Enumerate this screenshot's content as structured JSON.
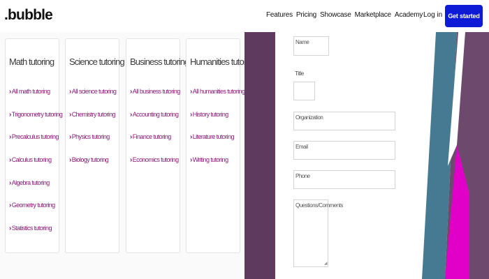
{
  "header": {
    "logo": ".bubble",
    "nav": [
      "Features",
      "Pricing",
      "Showcase",
      "Marketplace",
      "Academy"
    ],
    "login": "Log in",
    "cta": "Get started"
  },
  "cards": [
    {
      "title": "Math tutoring",
      "items": [
        "All math tutoring",
        "Trigonometry tutoring",
        "Precalculus tutoring",
        "Calculus tutoring",
        "Algebra tutoring",
        "Geometry tutoring",
        "Statistics tutoring"
      ]
    },
    {
      "title": "Science tutoring",
      "items": [
        "All science tutoring",
        "Chemistry tutoring",
        "Physics tutoring",
        "Biology tutoring"
      ]
    },
    {
      "title": "Business tutoring",
      "items": [
        "All business tutoring",
        "Accounting tutoring",
        "Finance tutoring",
        "Economics tutoring"
      ]
    },
    {
      "title": "Humanities tutoring",
      "items": [
        "All humanities tutoring",
        "History tutoring",
        "Literature tutoring",
        "Writing tutoring"
      ]
    }
  ],
  "form": {
    "name_placeholder": "Name",
    "title_label": "Title",
    "organization_placeholder": "Organization",
    "email_placeholder": "Email",
    "phone_placeholder": "Phone",
    "comment_placeholder": "Questions/Comments"
  },
  "colors": {
    "accent": "#0d1bd6",
    "link": "#8a1a7a",
    "purple_band": "#5e3a5e",
    "teal": "#467a93",
    "magenta": "#e000c8",
    "plum": "#6d4a6d"
  }
}
